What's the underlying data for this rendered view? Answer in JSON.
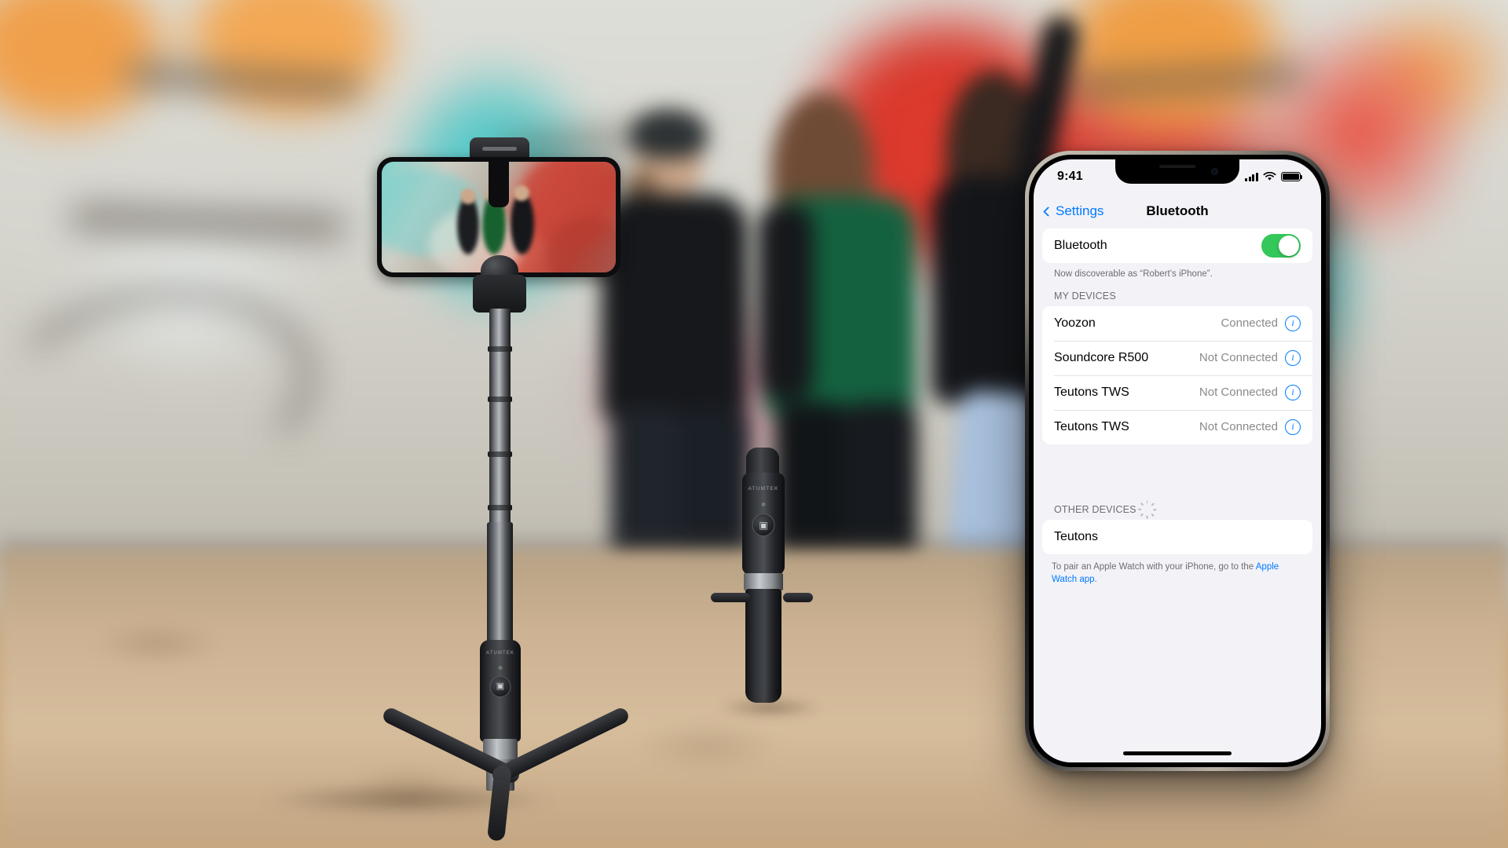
{
  "scene": {
    "description": "Product photo of a black selfie stick tripod beside an iPhone showing the Bluetooth settings screen",
    "brand_text": "ATUMTEK",
    "shutter_icon": "camera-icon"
  },
  "phone": {
    "status_bar": {
      "time": "9:41",
      "cellular_icon": "cellular-signal-icon",
      "wifi_icon": "wifi-icon",
      "battery_icon": "battery-full-icon"
    },
    "nav": {
      "back_label": "Settings",
      "back_icon": "chevron-left-icon",
      "title": "Bluetooth"
    },
    "bluetooth": {
      "label": "Bluetooth",
      "enabled": true,
      "toggle_color": "#34c759",
      "discoverable_note": "Now discoverable as “Robert’s iPhone”."
    },
    "my_devices": {
      "header": "MY DEVICES",
      "items": [
        {
          "name": "Yoozon",
          "status": "Connected",
          "info_icon": "info-circle-icon"
        },
        {
          "name": "Soundcore R500",
          "status": "Not Connected",
          "info_icon": "info-circle-icon"
        },
        {
          "name": "Teutons TWS",
          "status": "Not Connected",
          "info_icon": "info-circle-icon"
        },
        {
          "name": "Teutons TWS",
          "status": "Not Connected",
          "info_icon": "info-circle-icon"
        }
      ]
    },
    "other_devices": {
      "header": "OTHER DEVICES",
      "spinner_icon": "activity-spinner-icon",
      "items": [
        {
          "name": "Teutons"
        }
      ]
    },
    "pair_note": {
      "text_before": "To pair an Apple Watch with your iPhone, go to the ",
      "link_text": "Apple Watch app",
      "text_after": "."
    },
    "home_indicator": "home-indicator"
  },
  "colors": {
    "accent_blue": "#007aff",
    "toggle_green": "#34c759",
    "secondary_text": "#8a8a8e",
    "screen_bg": "#f2f2f7"
  }
}
